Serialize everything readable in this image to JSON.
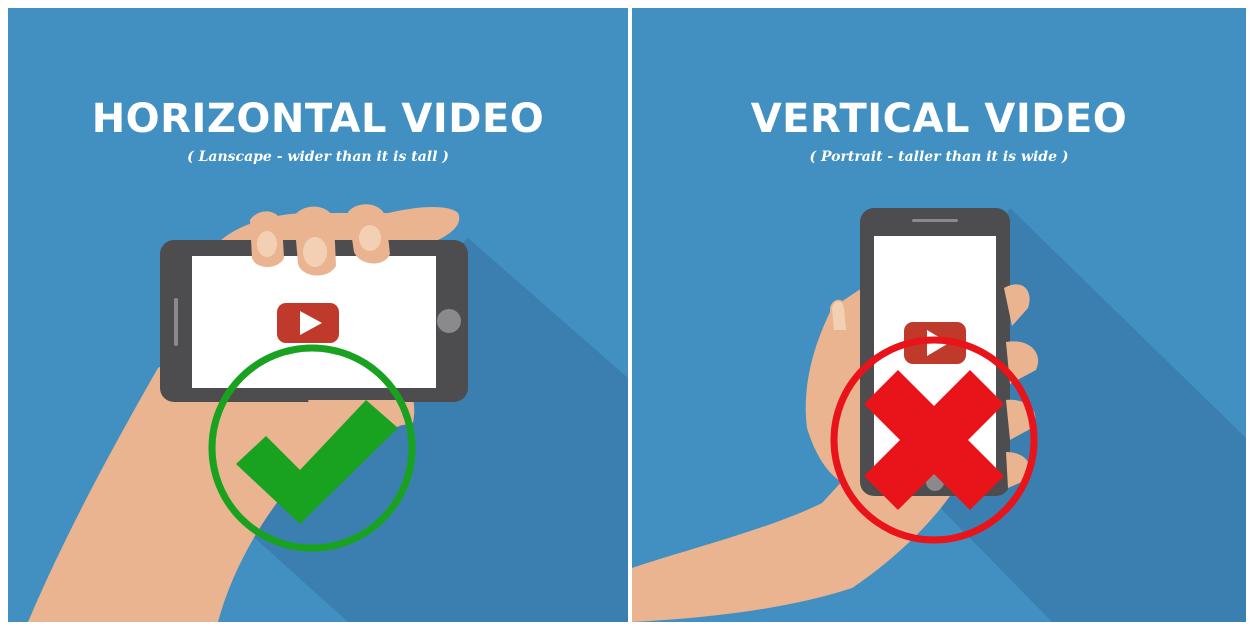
{
  "colors": {
    "background": "#4190c1",
    "shadow": "#3a7fb0",
    "phone": "#4d4d4f",
    "screen": "#ffffff",
    "skin": "#e9b48f",
    "skin_light": "#f3d0b4",
    "play_button": "#c03a2b",
    "check": "#19a21f",
    "cross": "#e8141a"
  },
  "left_panel": {
    "title": "HORIZONTAL VIDEO",
    "subtitle": "( Lanscape - wider than it is tall )",
    "verdict_icon": "checkmark-icon"
  },
  "right_panel": {
    "title": "VERTICAL VIDEO",
    "subtitle": "( Portrait - taller than it is wide )",
    "verdict_icon": "cross-icon"
  }
}
